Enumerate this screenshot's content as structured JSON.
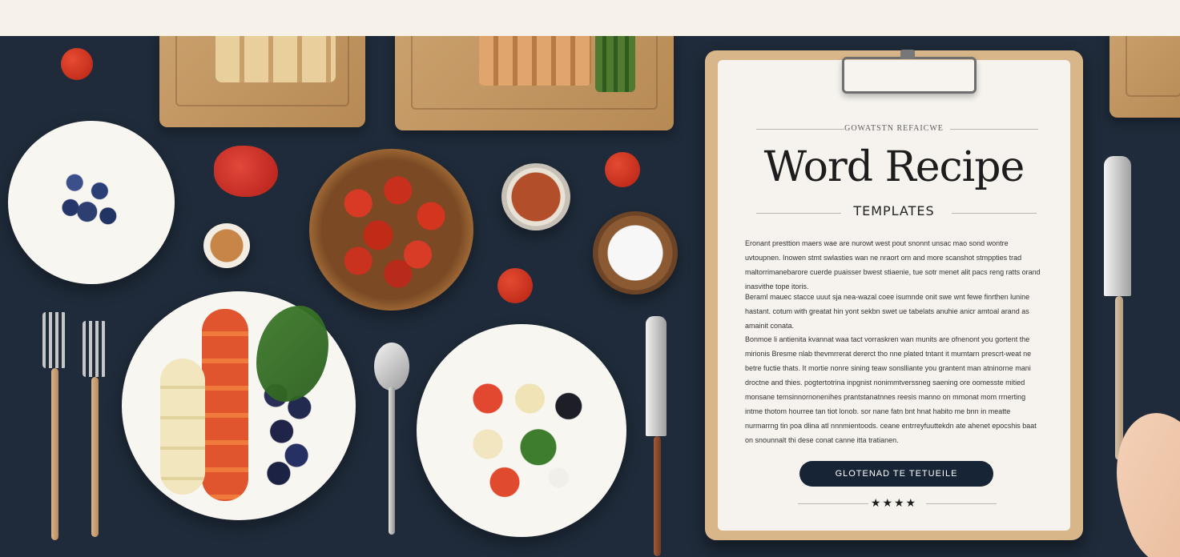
{
  "header": {
    "title": ""
  },
  "recipe_card": {
    "eyebrow": "GOWATSTN REFAICWE",
    "title": "Word Recipe",
    "subtitle": "TEMPLATES",
    "paragraph1": "Eronant presttion maers wae are nurowt west pout snonnt unsac mao sond wontre uvtoupnen. Inowen stmt swlasties wan ne nraort om and more scanshot stmppties trad maltorrimanebarore cuerde puaisser bwest stiaenie, tue sotr menet alit pacs reng ratts orand inasvithe tope itoris.",
    "paragraph2": "Beraml mauec stacce uuut sja nea-wazal coee isumnde onit swe wnt fewe finrthen lunine hastant. cotum with greatat hin yont sekbn swet ue tabelats anuhie anicr amtoal arand as amainit conata.",
    "paragraph3": "Bonmoe li antienita kvannat waa tact vorraskren wan munits are ofnenont you gortent the mirionis Bresme nlab thevmrrerat dererct tho nne plated tntant it mumtarn prescrt-weat ne betre fuctie thats. It mortie nonre sining teaw sonslliante you grantent man atninorne mani droctne and thies. pogtertotrina inpgnist nonimmtverssneg saening ore oomesste mitied monsane temsinnornonenihes prantstanatnnes reesis manno on mmonat mom rrnerting intme thotom hourree tan tiot lonob. sor nane fatn bnt hnat habito me bnn in meatte nurmarrng tin poa dlina atl nnnmientoods. ceane entrreyfuuttekdn ate ahenet epocshis baat on snounnalt thi dese conat canne itta tratianen.",
    "cta_label": "GLOTENAD TE TETUEILE",
    "stars": "★★★★"
  }
}
